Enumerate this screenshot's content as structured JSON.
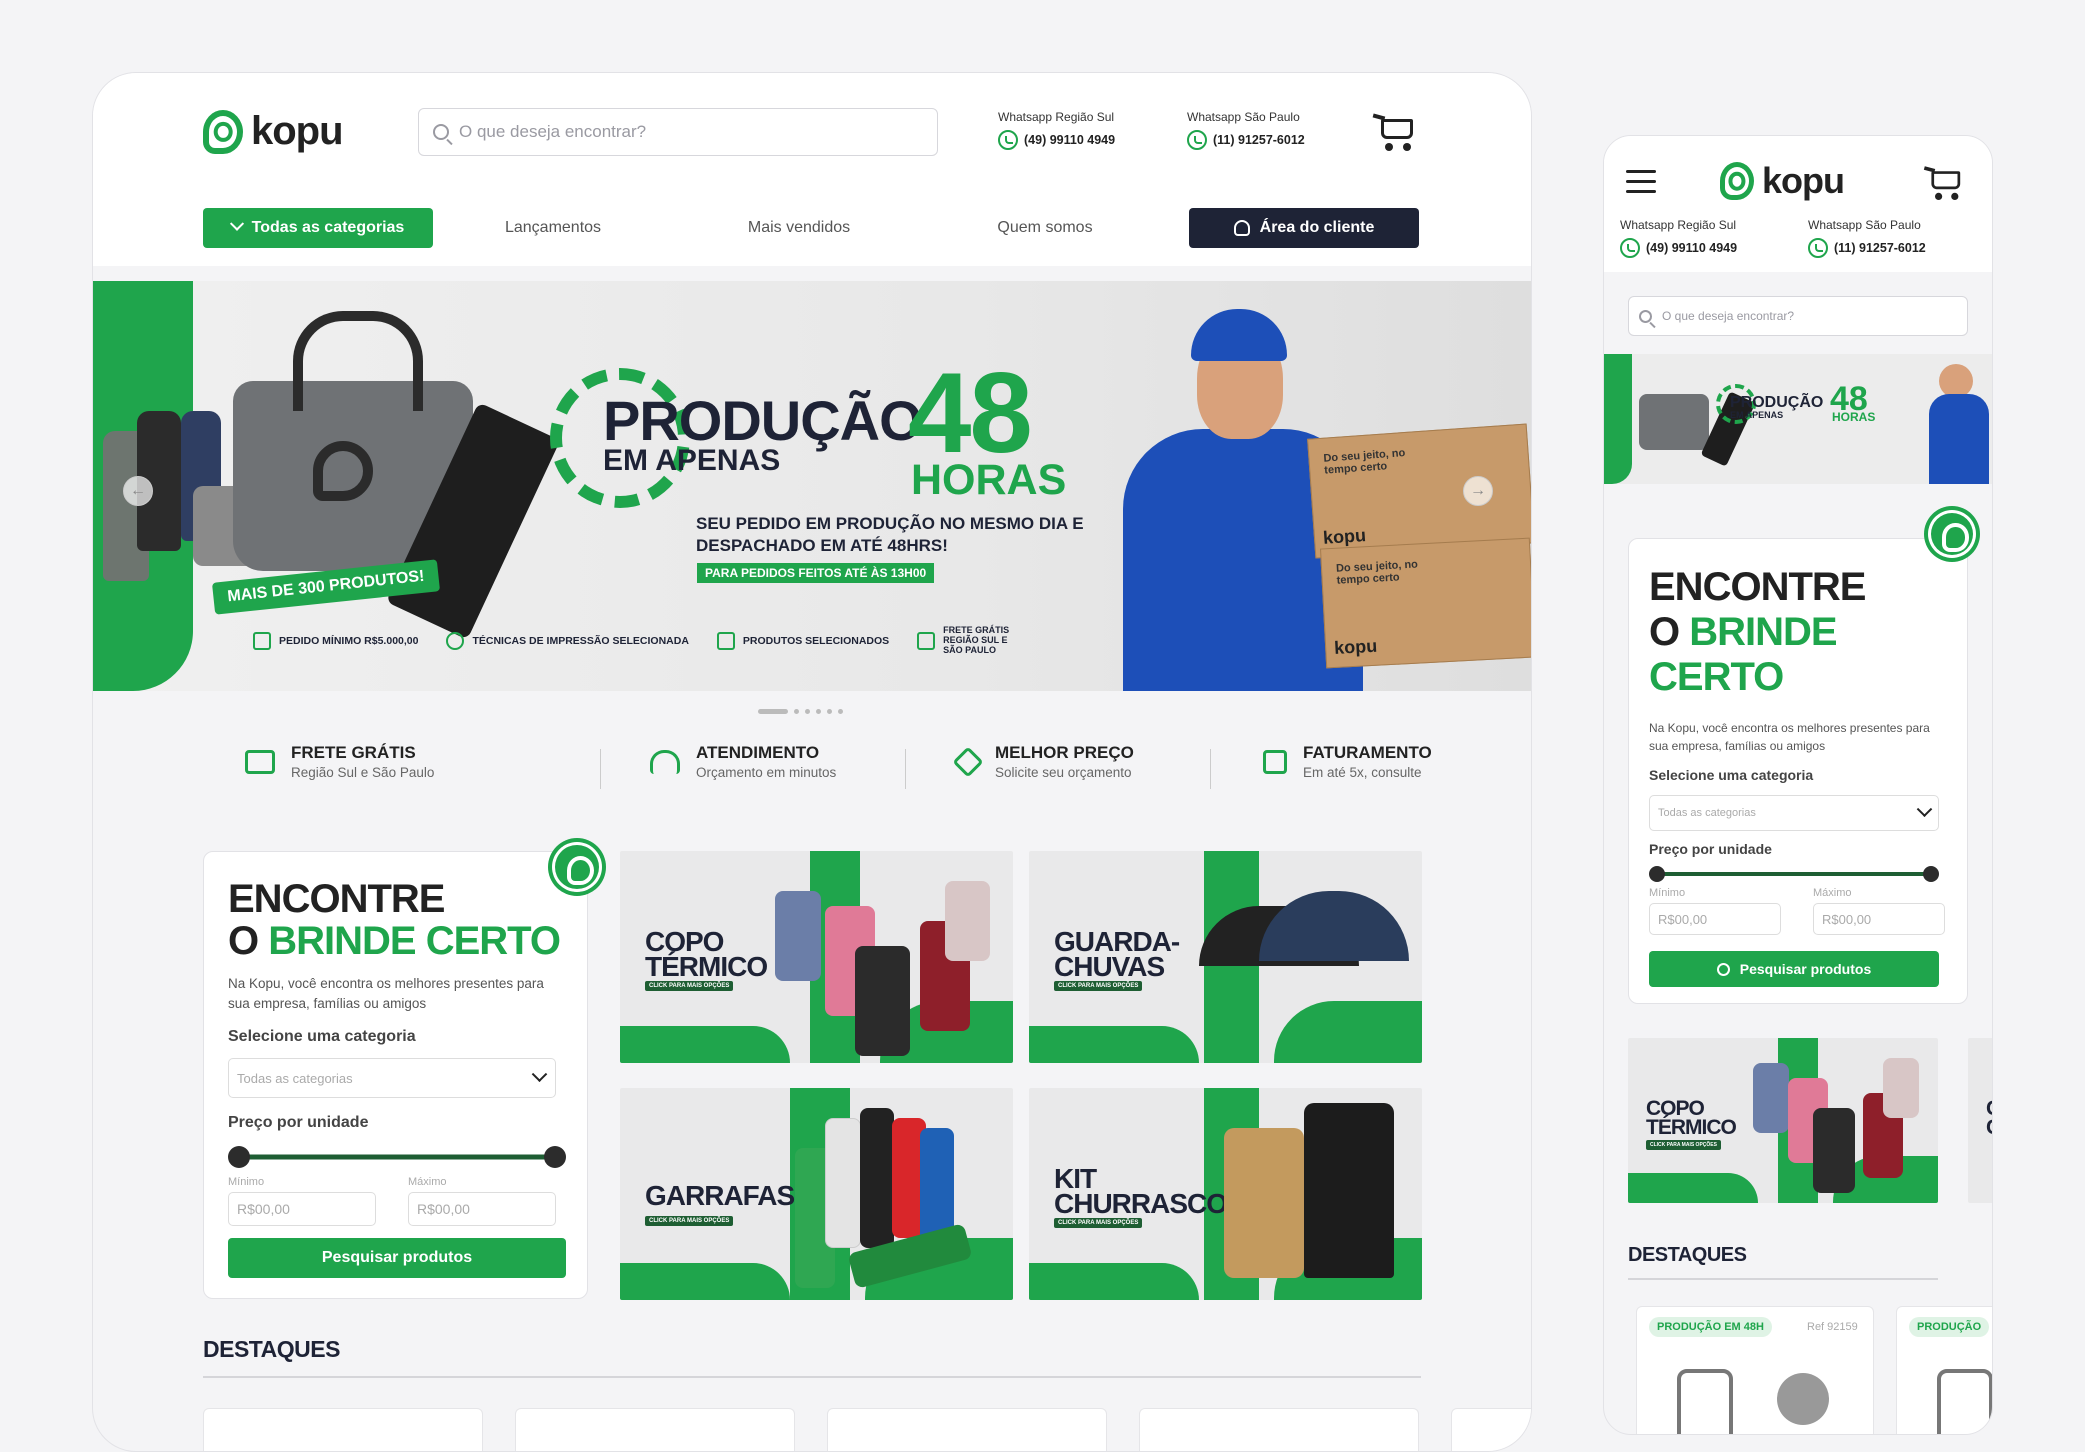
{
  "brand": {
    "name": "kopu",
    "accent": "#1fa54c",
    "dark": "#1e2336"
  },
  "header": {
    "search_placeholder": "O que deseja encontrar?",
    "whatsapp": [
      {
        "label": "Whatsapp Região Sul",
        "number": "(49) 99110 4949"
      },
      {
        "label": "Whatsapp São Paulo",
        "number": "(11) 91257-6012"
      }
    ],
    "cart_icon": "cart-icon"
  },
  "nav": {
    "categories": "Todas as categorias",
    "items": [
      "Lançamentos",
      "Mais vendidos",
      "Quem somos"
    ],
    "client_area": "Área do cliente"
  },
  "banner": {
    "headline_1": "PRODUÇÃO",
    "headline_2": "EM APENAS",
    "big_number": "48",
    "big_unit": "HORAS",
    "subtitle": "SEU PEDIDO EM PRODUÇÃO NO MESMO DIA E DESPACHADO EM ATÉ 48HRS!",
    "tag": "PARA PEDIDOS FEITOS ATÉ ÀS 13H00",
    "pill": "MAIS DE 300 PRODUTOS!",
    "box_text_1": "Do seu jeito, no tempo certo",
    "box_brand": "kopu",
    "features": [
      "PEDIDO MÍNIMO R$5.000,00",
      "TÉCNICAS DE IMPRESSÃO SELECIONADA",
      "PRODUTOS SELECIONADOS",
      "FRETE GRÁTIS REGIÃO SUL E SÃO PAULO"
    ],
    "prev_arrow": "←",
    "next_arrow": "→"
  },
  "benefits": [
    {
      "title": "FRETE GRÁTIS",
      "sub": "Região Sul e São Paulo",
      "icon": "truck-icon"
    },
    {
      "title": "ATENDIMENTO",
      "sub": "Orçamento em minutos",
      "icon": "headset-icon"
    },
    {
      "title": "MELHOR PREÇO",
      "sub": "Solicite seu orçamento",
      "icon": "tag-icon"
    },
    {
      "title": "FATURAMENTO",
      "sub": "Em até 5x, consulte",
      "icon": "calendar-icon"
    }
  ],
  "finder": {
    "title_1": "ENCONTRE",
    "title_2": "O ",
    "title_3": "BRINDE CERTO",
    "title_3a": "BRINDE",
    "title_3b": "CERTO",
    "description": "Na Kopu, você encontra os melhores presentes para sua empresa, famílias ou amigos",
    "category_label": "Selecione uma categoria",
    "category_value": "Todas as categorias",
    "price_label": "Preço por unidade",
    "min_label": "Mínimo",
    "max_label": "Máximo",
    "min_placeholder": "R$00,00",
    "max_placeholder": "R$00,00",
    "search_button": "Pesquisar produtos"
  },
  "tiles": [
    {
      "title_1": "COPO",
      "title_2": "TÉRMICO",
      "cta": "CLICK PARA MAIS OPÇÕES"
    },
    {
      "title_1": "GUARDA-",
      "title_2": "CHUVAS",
      "cta": "CLICK PARA MAIS OPÇÕES"
    },
    {
      "title_1": "GARRAFAS",
      "title_2": "",
      "cta": "CLICK PARA MAIS OPÇÕES"
    },
    {
      "title_1": "KIT",
      "title_2": "CHURRASCO",
      "cta": "CLICK PARA MAIS OPÇÕES"
    }
  ],
  "highlights": {
    "title": "DESTAQUES",
    "badge": "PRODUÇÃO EM 48H",
    "badge_cut": "PRODUÇÃO",
    "ref": "Ref 92159"
  }
}
